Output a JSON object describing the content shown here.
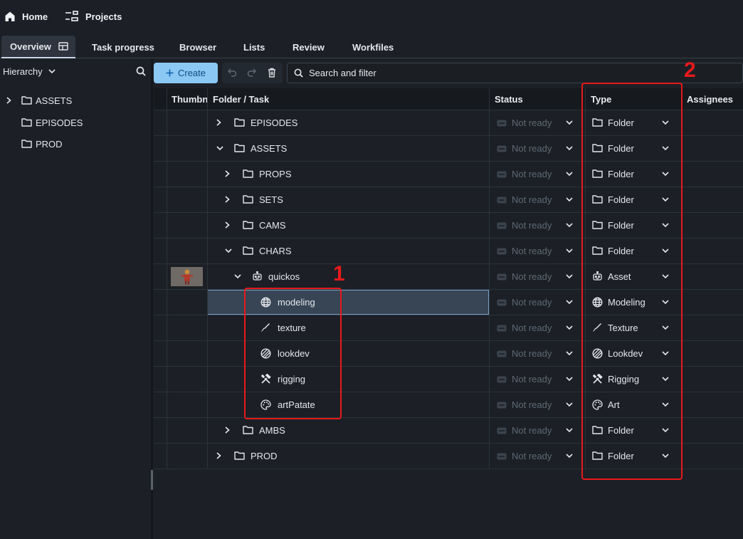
{
  "topbar": {
    "home": "Home",
    "projects": "Projects"
  },
  "tabs": [
    {
      "label": "Overview",
      "active": true
    },
    {
      "label": "Task progress"
    },
    {
      "label": "Browser"
    },
    {
      "label": "Lists"
    },
    {
      "label": "Review"
    },
    {
      "label": "Workfiles"
    }
  ],
  "sidebar": {
    "dropdown_label": "Hierarchy",
    "items": [
      {
        "label": "ASSETS",
        "expandable": true
      },
      {
        "label": "EPISODES"
      },
      {
        "label": "PROD"
      }
    ]
  },
  "toolbar": {
    "create_label": "Create",
    "search_placeholder": "Search and filter"
  },
  "table": {
    "columns": {
      "thumbnail": "Thumbn",
      "folder_task": "Folder / Task",
      "status": "Status",
      "type": "Type",
      "assignees": "Assignees"
    },
    "rows": [
      {
        "name": "EPISODES",
        "icon": "folder-icon",
        "depth": 0,
        "expander": "collapsed",
        "status": "Not ready",
        "type": "Folder",
        "type_icon": "folder-icon"
      },
      {
        "name": "ASSETS",
        "icon": "folder-icon",
        "depth": 0,
        "expander": "expanded",
        "status": "Not ready",
        "type": "Folder",
        "type_icon": "folder-icon"
      },
      {
        "name": "PROPS",
        "icon": "folder-icon",
        "depth": 1,
        "expander": "collapsed",
        "status": "Not ready",
        "type": "Folder",
        "type_icon": "folder-icon"
      },
      {
        "name": "SETS",
        "icon": "folder-icon",
        "depth": 1,
        "expander": "collapsed",
        "status": "Not ready",
        "type": "Folder",
        "type_icon": "folder-icon"
      },
      {
        "name": "CAMS",
        "icon": "folder-icon",
        "depth": 1,
        "expander": "collapsed",
        "status": "Not ready",
        "type": "Folder",
        "type_icon": "folder-icon"
      },
      {
        "name": "CHARS",
        "icon": "folder-icon",
        "depth": 1,
        "expander": "expanded",
        "status": "Not ready",
        "type": "Folder",
        "type_icon": "folder-icon"
      },
      {
        "name": "quickos",
        "icon": "asset-icon",
        "depth": 2,
        "expander": "expanded",
        "status": "Not ready",
        "type": "Asset",
        "type_icon": "asset-icon",
        "thumbnail": true
      },
      {
        "name": "modeling",
        "icon": "globe-icon",
        "depth": 3,
        "status": "Not ready",
        "type": "Modeling",
        "type_icon": "globe-icon",
        "selected": true
      },
      {
        "name": "texture",
        "icon": "brush-icon",
        "depth": 3,
        "status": "Not ready",
        "type": "Texture",
        "type_icon": "brush-icon"
      },
      {
        "name": "lookdev",
        "icon": "lookdev-icon",
        "depth": 3,
        "status": "Not ready",
        "type": "Lookdev",
        "type_icon": "lookdev-icon"
      },
      {
        "name": "rigging",
        "icon": "tools-icon",
        "depth": 3,
        "status": "Not ready",
        "type": "Rigging",
        "type_icon": "tools-icon"
      },
      {
        "name": "artPatate",
        "icon": "palette-icon",
        "depth": 3,
        "status": "Not ready",
        "type": "Art",
        "type_icon": "palette-icon"
      },
      {
        "name": "AMBS",
        "icon": "folder-icon",
        "depth": 1,
        "expander": "collapsed",
        "status": "Not ready",
        "type": "Folder",
        "type_icon": "folder-icon"
      },
      {
        "name": "PROD",
        "icon": "folder-icon",
        "depth": 0,
        "expander": "collapsed",
        "status": "Not ready",
        "type": "Folder",
        "type_icon": "folder-icon"
      }
    ]
  },
  "annotations": [
    {
      "label": "1"
    },
    {
      "label": "2"
    }
  ],
  "colors": {
    "accent": "#8cc8f4",
    "annotation": "#e8191b",
    "selected_row": "#374555"
  }
}
